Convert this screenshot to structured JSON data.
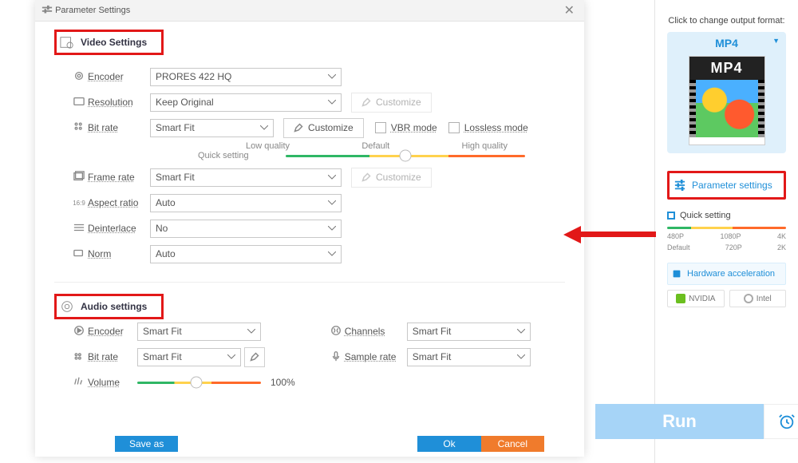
{
  "dialog": {
    "title": "Parameter Settings",
    "video": {
      "heading": "Video Settings",
      "encoder": {
        "label": "Encoder",
        "value": "PRORES 422 HQ"
      },
      "resolution": {
        "label": "Resolution",
        "value": "Keep Original",
        "customize": "Customize"
      },
      "bitrate": {
        "label": "Bit rate",
        "value": "Smart Fit",
        "customize": "Customize",
        "vbr": "VBR mode",
        "lossless": "Lossless mode"
      },
      "quickset_label": "Quick setting",
      "q_low": "Low quality",
      "q_default": "Default",
      "q_high": "High quality",
      "framerate": {
        "label": "Frame rate",
        "value": "Smart Fit",
        "customize": "Customize"
      },
      "aspect": {
        "label": "Aspect ratio",
        "value": "Auto"
      },
      "deinterlace": {
        "label": "Deinterlace",
        "value": "No"
      },
      "norm": {
        "label": "Norm",
        "value": "Auto"
      }
    },
    "audio": {
      "heading": "Audio settings",
      "encoder": {
        "label": "Encoder",
        "value": "Smart Fit"
      },
      "bitrate": {
        "label": "Bit rate",
        "value": "Smart Fit"
      },
      "volume": {
        "label": "Volume",
        "value": "100%"
      },
      "channels": {
        "label": "Channels",
        "value": "Smart Fit"
      },
      "samplerate": {
        "label": "Sample rate",
        "value": "Smart Fit"
      }
    },
    "buttons": {
      "saveas": "Save as",
      "ok": "Ok",
      "cancel": "Cancel"
    }
  },
  "side": {
    "hint": "Click to change output format:",
    "format": "MP4",
    "thumb_label": "MP4",
    "param_settings": "Parameter settings",
    "quick_setting": "Quick setting",
    "ticks_top": [
      "480P",
      "1080P",
      "4K"
    ],
    "ticks_bot": [
      "Default",
      "720P",
      "2K"
    ],
    "hw": "Hardware acceleration",
    "nvidia": "NVIDIA",
    "intel": "Intel",
    "run": "Run"
  }
}
